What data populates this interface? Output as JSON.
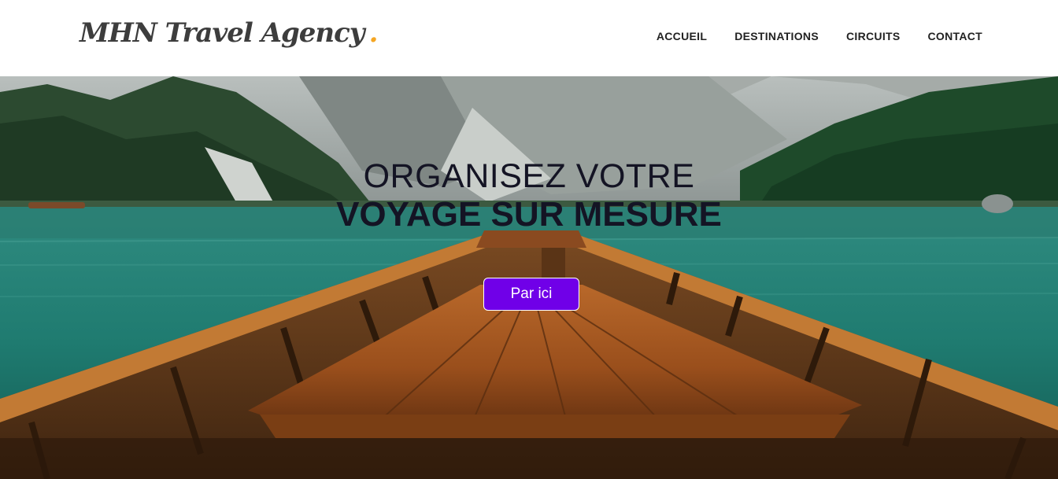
{
  "header": {
    "logo_text": "MHN Travel Agency",
    "logo_dot": ".",
    "nav": [
      {
        "label": "ACCUEIL"
      },
      {
        "label": "DESTINATIONS"
      },
      {
        "label": "CIRCUITS"
      },
      {
        "label": "CONTACT"
      }
    ]
  },
  "hero": {
    "title_line1": "ORGANISEZ VOTRE",
    "title_line2": "VOYAGE SUR MESURE",
    "cta_label": "Par ici"
  },
  "colors": {
    "accent_dot": "#f5a623",
    "button": "#7000e8",
    "title_text": "#141424"
  }
}
